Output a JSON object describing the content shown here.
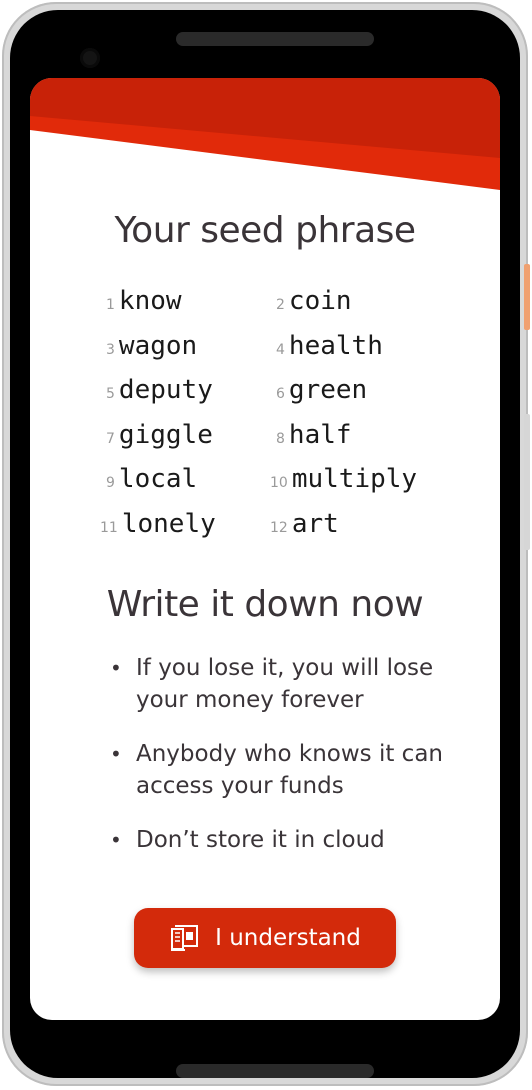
{
  "colors": {
    "accent": "#d32a0b",
    "accent_dark": "#c42208",
    "text": "#3a3438",
    "muted": "#9a9a9a"
  },
  "screen": {
    "title": "Your seed phrase",
    "seed_words": [
      {
        "index": "1",
        "word": "know"
      },
      {
        "index": "2",
        "word": "coin"
      },
      {
        "index": "3",
        "word": "wagon"
      },
      {
        "index": "4",
        "word": "health"
      },
      {
        "index": "5",
        "word": "deputy"
      },
      {
        "index": "6",
        "word": "green"
      },
      {
        "index": "7",
        "word": "giggle"
      },
      {
        "index": "8",
        "word": "half"
      },
      {
        "index": "9",
        "word": "local"
      },
      {
        "index": "10",
        "word": "multiply"
      },
      {
        "index": "11",
        "word": "lonely"
      },
      {
        "index": "12",
        "word": "art"
      }
    ],
    "warning_title": "Write it down now",
    "warnings": [
      "If you lose it, you will lose your money forever",
      "Anybody who knows it can access your funds",
      "Don’t store it in cloud"
    ],
    "bullet_glyph": "•",
    "button": {
      "label": "I understand",
      "icon": "book-icon"
    }
  }
}
